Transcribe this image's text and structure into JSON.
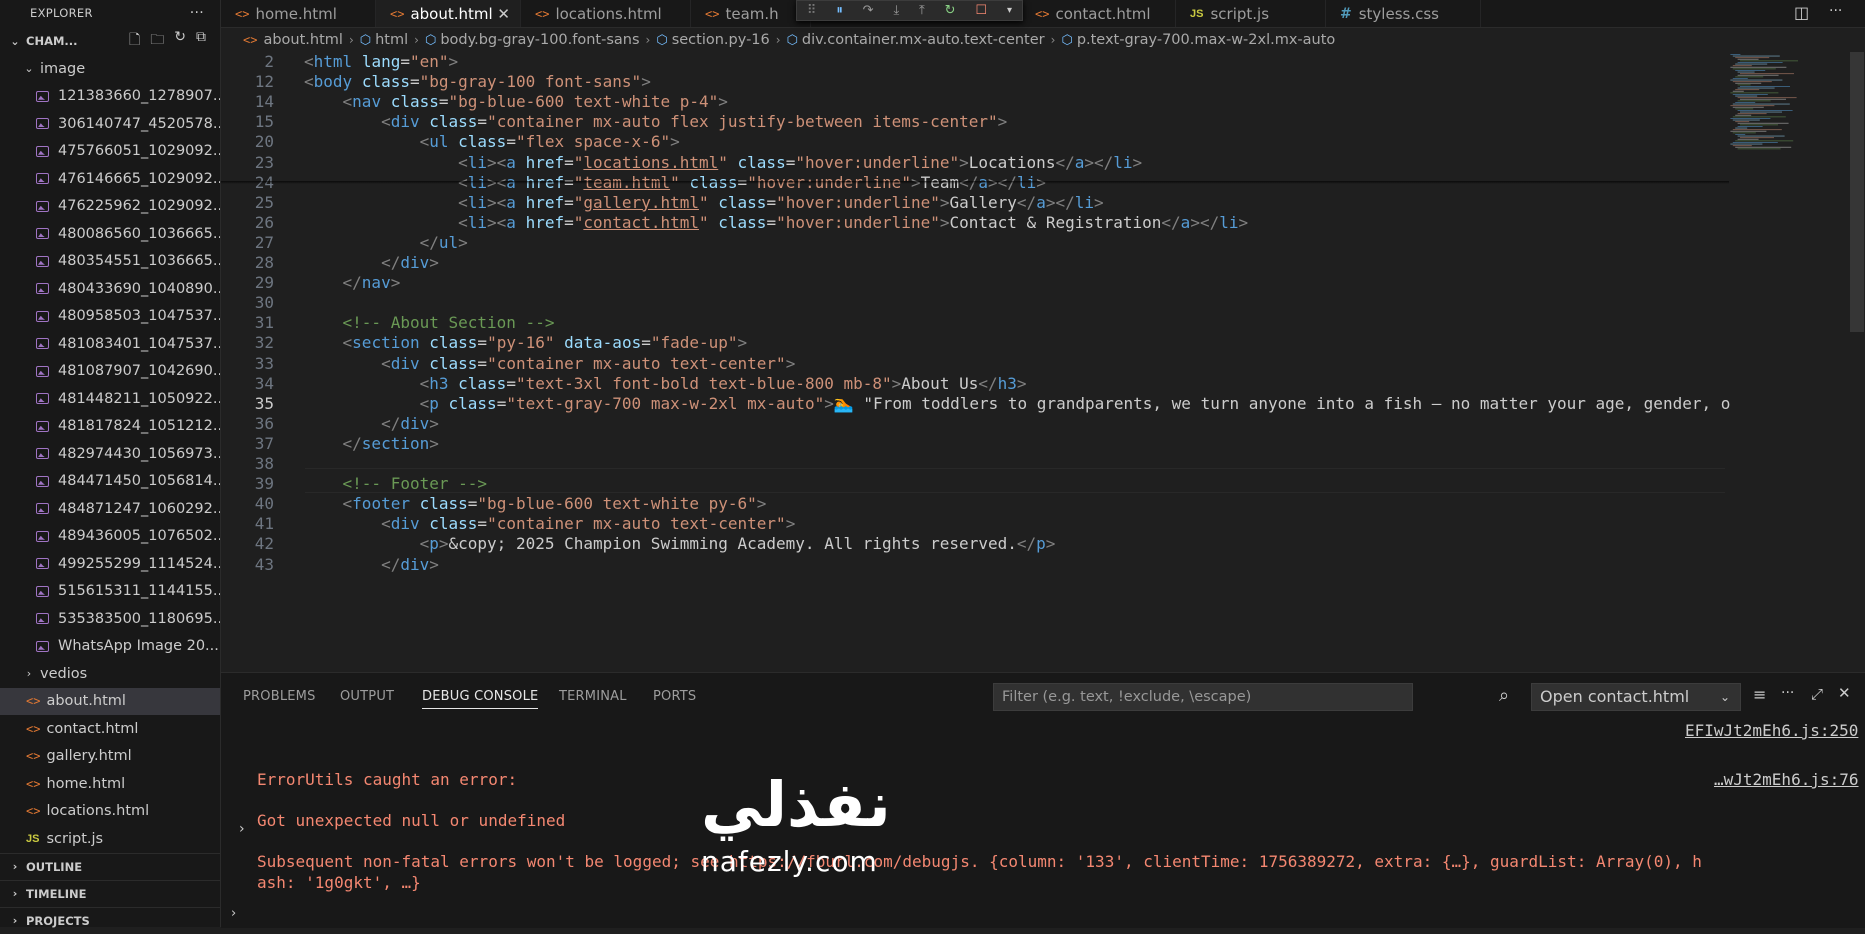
{
  "sidebar": {
    "title": "EXPLORER",
    "more": "···",
    "folder": "CHAM...",
    "image_folder": "image",
    "images": [
      "121383660_1278907...",
      "306140747_4520578...",
      "475766051_1029092...",
      "476146665_1029092...",
      "476225962_1029092...",
      "480086560_1036665...",
      "480354551_1036665...",
      "480433690_1040890...",
      "480958503_1047537...",
      "481083401_1047537...",
      "481087907_1042690...",
      "481448211_1050922...",
      "481817824_1051212...",
      "482974430_1056973...",
      "484471450_1056814...",
      "484871247_1060292...",
      "489436005_1076502...",
      "499255299_1114524...",
      "515615311_1144155...",
      "535383500_1180695...",
      "WhatsApp Image 20..."
    ],
    "vedios": "vedios",
    "files": [
      "about.html",
      "contact.html",
      "gallery.html",
      "home.html",
      "locations.html",
      "script.js"
    ],
    "outline": "OUTLINE",
    "timeline": "TIMELINE",
    "projects": "PROJECTS"
  },
  "tabs": [
    "home.html",
    "about.html",
    "locations.html",
    "team.h",
    "contact.html",
    "script.js",
    "styless.css"
  ],
  "breadcrumb": [
    "about.html",
    "html",
    "body.bg-gray-100.font-sans",
    "section.py-16",
    "div.container.mx-auto.text-center",
    "p.text-gray-700.max-w-2xl.mx-auto"
  ],
  "lines": [
    {
      "n": "2",
      "segs": [
        [
          "p",
          "<"
        ],
        [
          "t",
          "html"
        ],
        [
          "x",
          " "
        ],
        [
          "a",
          "lang"
        ],
        [
          "x",
          "="
        ],
        [
          "s",
          "\"en\""
        ],
        [
          "p",
          ">"
        ]
      ]
    },
    {
      "n": "12",
      "segs": [
        [
          "p",
          "<"
        ],
        [
          "t",
          "body"
        ],
        [
          "x",
          " "
        ],
        [
          "a",
          "class"
        ],
        [
          "x",
          "="
        ],
        [
          "s",
          "\"bg-gray-100 font-sans\""
        ],
        [
          "p",
          ">"
        ]
      ]
    },
    {
      "n": "14",
      "segs": [
        [
          "x",
          "    "
        ],
        [
          "p",
          "<"
        ],
        [
          "t",
          "nav"
        ],
        [
          "x",
          " "
        ],
        [
          "a",
          "class"
        ],
        [
          "x",
          "="
        ],
        [
          "s",
          "\"bg-blue-600 text-white p-4\""
        ],
        [
          "p",
          ">"
        ]
      ]
    },
    {
      "n": "15",
      "segs": [
        [
          "x",
          "        "
        ],
        [
          "p",
          "<"
        ],
        [
          "t",
          "div"
        ],
        [
          "x",
          " "
        ],
        [
          "a",
          "class"
        ],
        [
          "x",
          "="
        ],
        [
          "s",
          "\"container mx-auto flex justify-between items-center\""
        ],
        [
          "p",
          ">"
        ]
      ]
    },
    {
      "n": "20",
      "segs": [
        [
          "x",
          "            "
        ],
        [
          "p",
          "<"
        ],
        [
          "t",
          "ul"
        ],
        [
          "x",
          " "
        ],
        [
          "a",
          "class"
        ],
        [
          "x",
          "="
        ],
        [
          "s",
          "\"flex space-x-6\""
        ],
        [
          "p",
          ">"
        ]
      ]
    },
    {
      "n": "23",
      "segs": [
        [
          "x",
          "                "
        ],
        [
          "p",
          "<"
        ],
        [
          "t",
          "li"
        ],
        [
          "p",
          "><"
        ],
        [
          "t",
          "a"
        ],
        [
          "x",
          " "
        ],
        [
          "a",
          "href"
        ],
        [
          "x",
          "="
        ],
        [
          "s",
          "\""
        ],
        [
          "su",
          "locations.html"
        ],
        [
          "s",
          "\""
        ],
        [
          "x",
          " "
        ],
        [
          "a",
          "class"
        ],
        [
          "x",
          "="
        ],
        [
          "s",
          "\"hover:underline\""
        ],
        [
          "p",
          ">"
        ],
        [
          "x",
          "Locations"
        ],
        [
          "p",
          "</"
        ],
        [
          "t",
          "a"
        ],
        [
          "p",
          "></"
        ],
        [
          "t",
          "li"
        ],
        [
          "p",
          ">"
        ]
      ]
    },
    {
      "n": "24",
      "segs": [
        [
          "x",
          "                "
        ],
        [
          "p",
          "<"
        ],
        [
          "t",
          "li"
        ],
        [
          "p",
          "><"
        ],
        [
          "t",
          "a"
        ],
        [
          "x",
          " "
        ],
        [
          "a",
          "href"
        ],
        [
          "x",
          "="
        ],
        [
          "s",
          "\""
        ],
        [
          "su",
          "team.html"
        ],
        [
          "s",
          "\""
        ],
        [
          "x",
          " "
        ],
        [
          "a",
          "class"
        ],
        [
          "x",
          "="
        ],
        [
          "s",
          "\"hover:underline\""
        ],
        [
          "p",
          ">"
        ],
        [
          "x",
          "Team"
        ],
        [
          "p",
          "</"
        ],
        [
          "t",
          "a"
        ],
        [
          "p",
          "></"
        ],
        [
          "t",
          "li"
        ],
        [
          "p",
          ">"
        ]
      ]
    },
    {
      "n": "25",
      "segs": [
        [
          "x",
          "                "
        ],
        [
          "p",
          "<"
        ],
        [
          "t",
          "li"
        ],
        [
          "p",
          "><"
        ],
        [
          "t",
          "a"
        ],
        [
          "x",
          " "
        ],
        [
          "a",
          "href"
        ],
        [
          "x",
          "="
        ],
        [
          "s",
          "\""
        ],
        [
          "su",
          "gallery.html"
        ],
        [
          "s",
          "\""
        ],
        [
          "x",
          " "
        ],
        [
          "a",
          "class"
        ],
        [
          "x",
          "="
        ],
        [
          "s",
          "\"hover:underline\""
        ],
        [
          "p",
          ">"
        ],
        [
          "x",
          "Gallery"
        ],
        [
          "p",
          "</"
        ],
        [
          "t",
          "a"
        ],
        [
          "p",
          "></"
        ],
        [
          "t",
          "li"
        ],
        [
          "p",
          ">"
        ]
      ]
    },
    {
      "n": "26",
      "segs": [
        [
          "x",
          "                "
        ],
        [
          "p",
          "<"
        ],
        [
          "t",
          "li"
        ],
        [
          "p",
          "><"
        ],
        [
          "t",
          "a"
        ],
        [
          "x",
          " "
        ],
        [
          "a",
          "href"
        ],
        [
          "x",
          "="
        ],
        [
          "s",
          "\""
        ],
        [
          "su",
          "contact.html"
        ],
        [
          "s",
          "\""
        ],
        [
          "x",
          " "
        ],
        [
          "a",
          "class"
        ],
        [
          "x",
          "="
        ],
        [
          "s",
          "\"hover:underline\""
        ],
        [
          "p",
          ">"
        ],
        [
          "x",
          "Contact & Registration"
        ],
        [
          "p",
          "</"
        ],
        [
          "t",
          "a"
        ],
        [
          "p",
          "></"
        ],
        [
          "t",
          "li"
        ],
        [
          "p",
          ">"
        ]
      ]
    },
    {
      "n": "27",
      "segs": [
        [
          "x",
          "            "
        ],
        [
          "p",
          "</"
        ],
        [
          "t",
          "ul"
        ],
        [
          "p",
          ">"
        ]
      ]
    },
    {
      "n": "28",
      "segs": [
        [
          "x",
          "        "
        ],
        [
          "p",
          "</"
        ],
        [
          "t",
          "div"
        ],
        [
          "p",
          ">"
        ]
      ]
    },
    {
      "n": "29",
      "segs": [
        [
          "x",
          "    "
        ],
        [
          "p",
          "</"
        ],
        [
          "t",
          "nav"
        ],
        [
          "p",
          ">"
        ]
      ]
    },
    {
      "n": "30",
      "segs": []
    },
    {
      "n": "31",
      "segs": [
        [
          "x",
          "    "
        ],
        [
          "c",
          "<!-- About Section -->"
        ]
      ]
    },
    {
      "n": "32",
      "segs": [
        [
          "x",
          "    "
        ],
        [
          "p",
          "<"
        ],
        [
          "t",
          "section"
        ],
        [
          "x",
          " "
        ],
        [
          "a",
          "class"
        ],
        [
          "x",
          "="
        ],
        [
          "s",
          "\"py-16\""
        ],
        [
          "x",
          " "
        ],
        [
          "a",
          "data-aos"
        ],
        [
          "x",
          "="
        ],
        [
          "s",
          "\"fade-up\""
        ],
        [
          "p",
          ">"
        ]
      ]
    },
    {
      "n": "33",
      "segs": [
        [
          "x",
          "        "
        ],
        [
          "p",
          "<"
        ],
        [
          "t",
          "div"
        ],
        [
          "x",
          " "
        ],
        [
          "a",
          "class"
        ],
        [
          "x",
          "="
        ],
        [
          "s",
          "\"container mx-auto text-center\""
        ],
        [
          "p",
          ">"
        ]
      ]
    },
    {
      "n": "34",
      "segs": [
        [
          "x",
          "            "
        ],
        [
          "p",
          "<"
        ],
        [
          "t",
          "h3"
        ],
        [
          "x",
          " "
        ],
        [
          "a",
          "class"
        ],
        [
          "x",
          "="
        ],
        [
          "s",
          "\"text-3xl font-bold text-blue-800 mb-8\""
        ],
        [
          "p",
          ">"
        ],
        [
          "x",
          "About Us"
        ],
        [
          "p",
          "</"
        ],
        [
          "t",
          "h3"
        ],
        [
          "p",
          ">"
        ]
      ]
    },
    {
      "n": "35",
      "segs": [
        [
          "x",
          "            "
        ],
        [
          "p",
          "<"
        ],
        [
          "t",
          "p"
        ],
        [
          "x",
          " "
        ],
        [
          "a",
          "class"
        ],
        [
          "x",
          "="
        ],
        [
          "s",
          "\"text-gray-700 max-w-2xl mx-auto\""
        ],
        [
          "p",
          ">"
        ],
        [
          "x",
          "🏊 \"From toddlers to grandparents, we turn anyone into a fish — no matter your age, gender, o"
        ]
      ]
    },
    {
      "n": "36",
      "segs": [
        [
          "x",
          "        "
        ],
        [
          "p",
          "</"
        ],
        [
          "t",
          "div"
        ],
        [
          "p",
          ">"
        ]
      ]
    },
    {
      "n": "37",
      "segs": [
        [
          "x",
          "    "
        ],
        [
          "p",
          "</"
        ],
        [
          "t",
          "section"
        ],
        [
          "p",
          ">"
        ]
      ]
    },
    {
      "n": "38",
      "segs": []
    },
    {
      "n": "39",
      "segs": [
        [
          "x",
          "    "
        ],
        [
          "c",
          "<!-- Footer -->"
        ]
      ]
    },
    {
      "n": "40",
      "segs": [
        [
          "x",
          "    "
        ],
        [
          "p",
          "<"
        ],
        [
          "t",
          "footer"
        ],
        [
          "x",
          " "
        ],
        [
          "a",
          "class"
        ],
        [
          "x",
          "="
        ],
        [
          "s",
          "\"bg-blue-600 text-white py-6\""
        ],
        [
          "p",
          ">"
        ]
      ]
    },
    {
      "n": "41",
      "segs": [
        [
          "x",
          "        "
        ],
        [
          "p",
          "<"
        ],
        [
          "t",
          "div"
        ],
        [
          "x",
          " "
        ],
        [
          "a",
          "class"
        ],
        [
          "x",
          "="
        ],
        [
          "s",
          "\"container mx-auto text-center\""
        ],
        [
          "p",
          ">"
        ]
      ]
    },
    {
      "n": "42",
      "segs": [
        [
          "x",
          "            "
        ],
        [
          "p",
          "<"
        ],
        [
          "t",
          "p"
        ],
        [
          "p",
          ">"
        ],
        [
          "x",
          "&copy; 2025 Champion Swimming Academy. All rights reserved."
        ],
        [
          "p",
          "</"
        ],
        [
          "t",
          "p"
        ],
        [
          "p",
          ">"
        ]
      ]
    },
    {
      "n": "43",
      "segs": [
        [
          "x",
          "        "
        ],
        [
          "p",
          "</"
        ],
        [
          "t",
          "div"
        ],
        [
          "p",
          ">"
        ]
      ]
    }
  ],
  "panel": {
    "tabs": [
      "PROBLEMS",
      "OUTPUT",
      "DEBUG CONSOLE",
      "TERMINAL",
      "PORTS"
    ],
    "filter_placeholder": "Filter (e.g. text, !exclude, \\escape)",
    "open_select": "Open contact.html",
    "link1": "EFIwJt2mEh6.js:250",
    "link2": "…wJt2mEh6.js:76",
    "err1": "ErrorUtils caught an error:",
    "err2": "Got unexpected null or undefined",
    "err3": "Subsequent non-fatal errors won't be logged; see https://fburl.com/debugjs. {column: '133', clientTime: 1756389272, extra: {…}, guardList: Array(0), h",
    "err4": "ash: '1g0gkt', …}"
  },
  "watermark": {
    "arabic": "نفذلي",
    "latin": "nafezly.com"
  }
}
